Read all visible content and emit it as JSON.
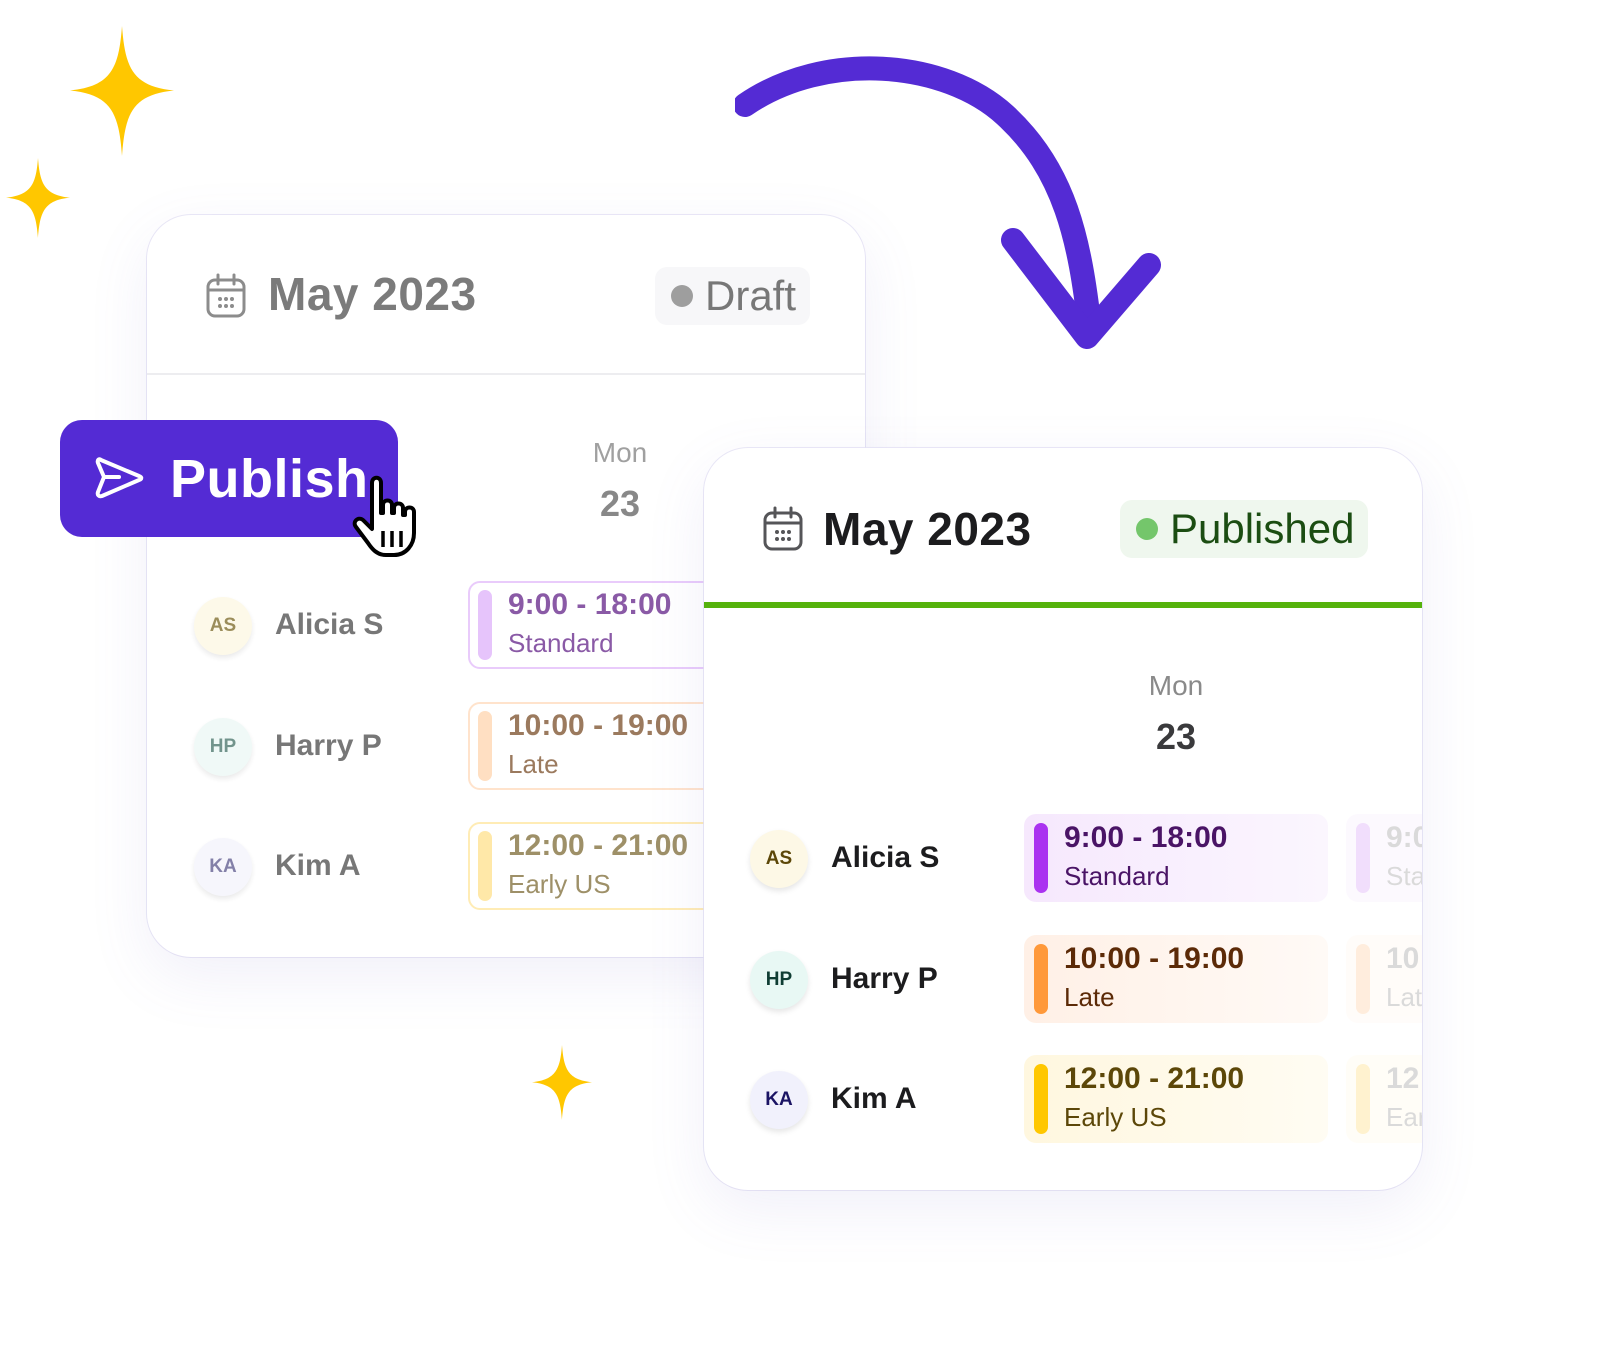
{
  "decorations": {
    "sparkle_color": "#ffc700",
    "arrow_color": "#542bd4"
  },
  "publish_button": {
    "label": "Publish",
    "icon": "send-icon",
    "background": "#542bd4"
  },
  "draft_card": {
    "title": "May 2023",
    "icon": "calendar-icon",
    "status": "Draft",
    "status_dot_color": "#9e9e9e",
    "day": {
      "dow": "Mon",
      "date": "23"
    },
    "rows": [
      {
        "initials": "AS",
        "name": "Alicia S",
        "time": "9:00 - 18:00",
        "type": "Standard"
      },
      {
        "initials": "HP",
        "name": "Harry P",
        "time": "10:00 - 19:00",
        "type": "Late"
      },
      {
        "initials": "KA",
        "name": "Kim A",
        "time": "12:00 - 21:00",
        "type": "Early US"
      }
    ]
  },
  "published_card": {
    "title": "May 2023",
    "icon": "calendar-icon",
    "status": "Published",
    "status_dot_color": "#74c66b",
    "accent_line_color": "#55b20c",
    "day": {
      "dow": "Mon",
      "date": "23"
    },
    "rows": [
      {
        "initials": "AS",
        "name": "Alicia S",
        "time": "9:00 - 18:00",
        "type": "Standard",
        "ghost_time": "9:0",
        "ghost_type": "Sta"
      },
      {
        "initials": "HP",
        "name": "Harry P",
        "time": "10:00 - 19:00",
        "type": "Late",
        "ghost_time": "10",
        "ghost_type": "Lat"
      },
      {
        "initials": "KA",
        "name": "Kim A",
        "time": "12:00 - 21:00",
        "type": "Early US",
        "ghost_time": "12:",
        "ghost_type": "Ear"
      }
    ]
  },
  "shift_colors": {
    "standard": {
      "bar": "#aa33f0",
      "bar_light": "#e6c4fb",
      "text": "#4a1466",
      "bg": "#f7e9fd",
      "border": "#e6c4fb"
    },
    "late": {
      "bar": "#ff993a",
      "bar_light": "#ffdfc2",
      "text": "#5c2a07",
      "bg": "#fff1e8",
      "border": "#ffdfc2"
    },
    "early_us": {
      "bar": "#ffc700",
      "bar_light": "#ffe8a8",
      "text": "#5c4708",
      "bg": "#fff8e0",
      "border": "#ffe8a8"
    }
  },
  "avatar_colors": {
    "AS": {
      "bg": "#fdf8e6",
      "fg": "#5c4708"
    },
    "HP": {
      "bg": "#e8f8f4",
      "fg": "#0f3d33"
    },
    "KA": {
      "bg": "#f1f1fc",
      "fg": "#1b1464"
    }
  }
}
